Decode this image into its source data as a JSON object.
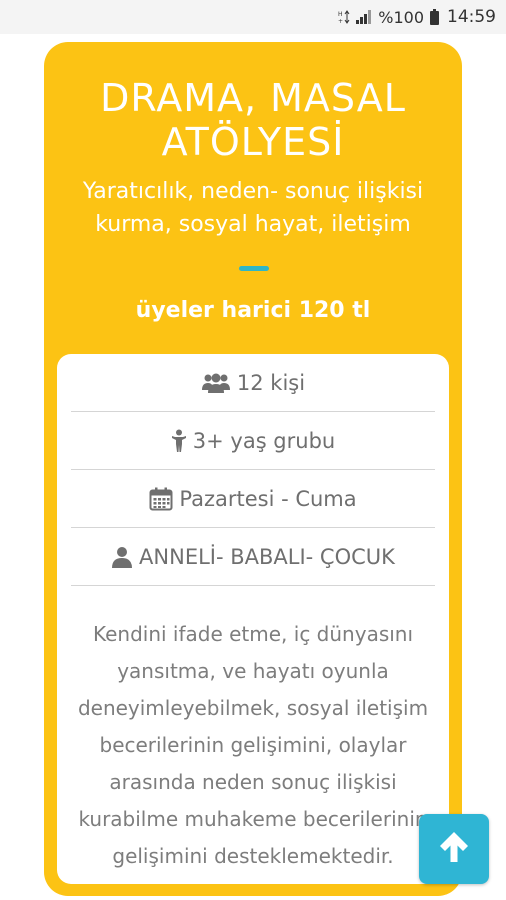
{
  "status_bar": {
    "network_icon": "data-network-icon",
    "signal_icon": "signal-strength-icon",
    "battery_percent": "%100",
    "battery_icon": "battery-icon",
    "time": "14:59"
  },
  "card": {
    "title": "DRAMA, MASAL ATÖLYESİ",
    "subtitle": "Yaratıcılık, neden- sonuç ilişkisi kurma, sosyal hayat, iletişim",
    "price": "üyeler harici 120 tl",
    "accent_color": "#fcc314",
    "divider_color": "#2fb6c6"
  },
  "details": {
    "capacity": {
      "icon": "users-icon",
      "text": "12 kişi"
    },
    "age_group": {
      "icon": "child-icon",
      "text": "3+ yaş grubu"
    },
    "days": {
      "icon": "calendar-icon",
      "text": "Pazartesi - Cuma"
    },
    "audience": {
      "icon": "user-icon",
      "text": "ANNELİ- BABALI- ÇOCUK"
    }
  },
  "description": "Kendini ifade etme, iç dünyasını yansıtma, ve hayatı oyunla deneyimleyebilmek, sosyal iletişim becerilerinin gelişimini, olaylar arasında neden sonuç ilişkisi kurabilme muhakeme becerilerinin gelişimini desteklemektedir.",
  "scroll_top_button": {
    "icon": "arrow-up-icon",
    "color": "#2fb5d4"
  }
}
